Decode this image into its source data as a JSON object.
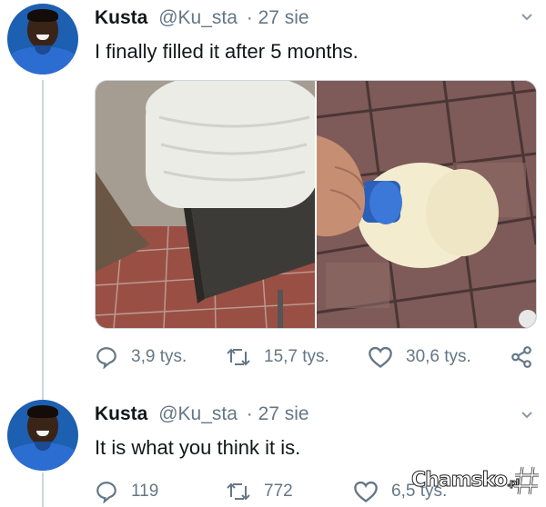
{
  "tweets": [
    {
      "author_name": "Kusta",
      "handle": "@Ku_sta",
      "date": "· 27 sie",
      "text": "I finally filled it after 5 months.",
      "replies": "3,9 tys.",
      "retweets": "15,7 tys.",
      "likes": "30,6 tys."
    },
    {
      "author_name": "Kusta",
      "handle": "@Ku_sta",
      "date": "· 27 sie",
      "text": "It is what you think it is.",
      "replies": "119",
      "retweets": "772",
      "likes": "6,5 tys."
    }
  ],
  "watermark": {
    "main": "Chamsko",
    "suffix": ".pl"
  },
  "colors": {
    "text": "#14171a",
    "muted": "#657786",
    "line": "#ccd6dd",
    "accent": "#2c6dd1"
  },
  "icons": [
    "reply-icon",
    "retweet-icon",
    "like-icon",
    "share-icon",
    "chevron-down-icon"
  ]
}
